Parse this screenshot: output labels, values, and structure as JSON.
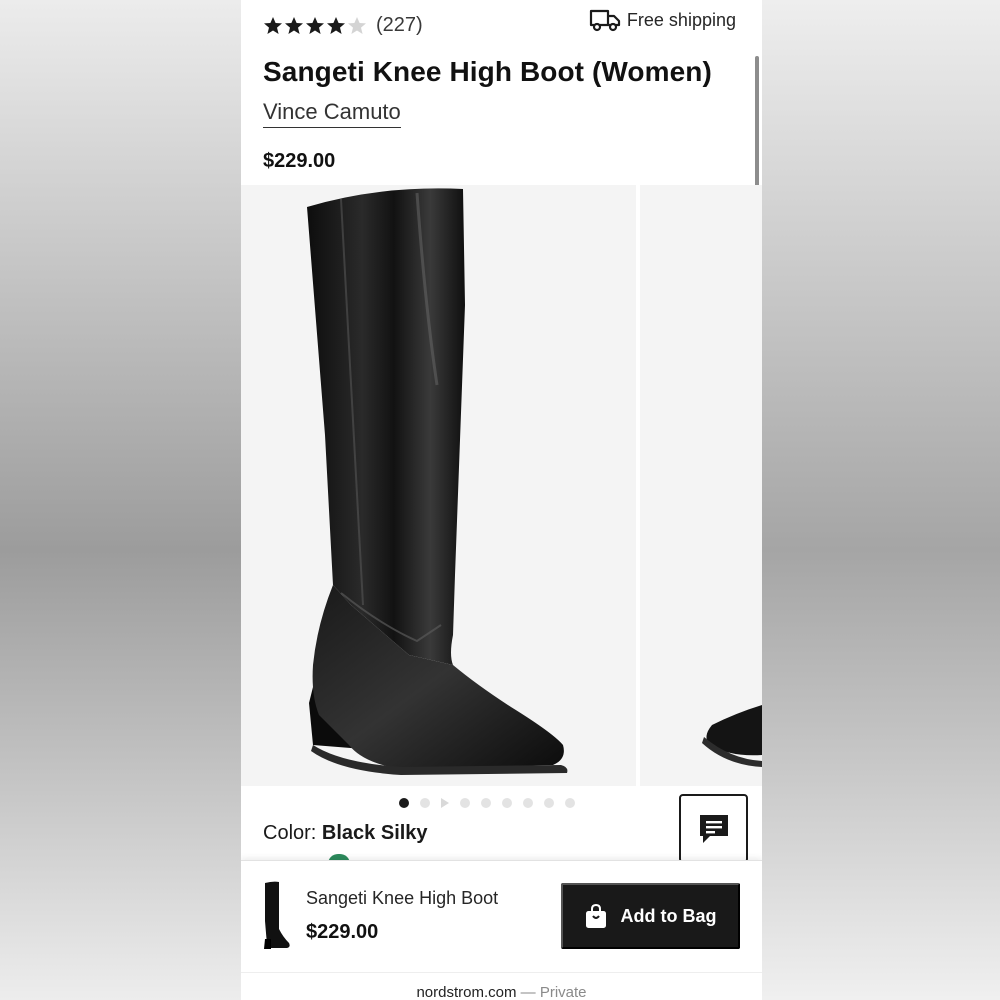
{
  "product": {
    "rating_stars": 4,
    "rating_max": 5,
    "review_count": "(227)",
    "shipping_label": "Free shipping",
    "title": "Sangeti Knee High Boot (Women)",
    "brand": "Vince Camuto",
    "price": "$229.00"
  },
  "gallery": {
    "image_count": 8,
    "active_index": 0
  },
  "color": {
    "label": "Color:",
    "value": "Black Silky"
  },
  "sticky_bar": {
    "title": "Sangeti Knee High Boot",
    "price": "$229.00",
    "add_button_label": "Add to Bag"
  },
  "browser": {
    "domain": "nordstrom.com",
    "separator": "—",
    "mode": "Private"
  },
  "icons": {
    "truck": "truck-icon",
    "chat": "chat-icon",
    "bag": "shopping-bag-icon",
    "star": "star-icon"
  },
  "colors": {
    "star_filled": "#1a1a1a",
    "star_empty": "#d4d4d4",
    "button_bg": "#191919",
    "swatch_green": "#2c8a5c"
  }
}
